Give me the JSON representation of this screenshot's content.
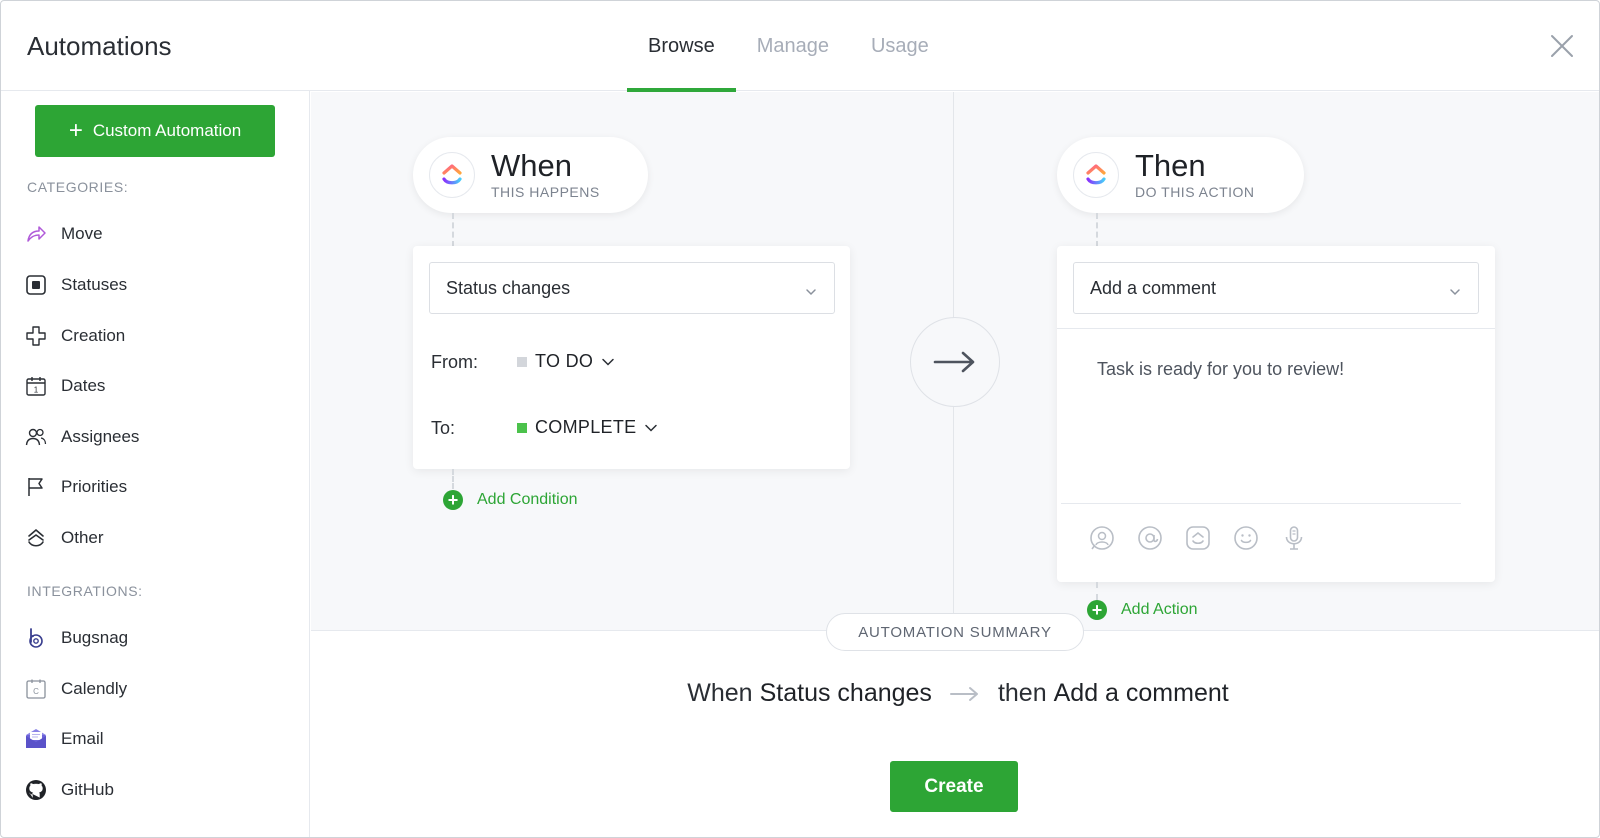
{
  "header": {
    "title": "Automations",
    "tabs": [
      {
        "label": "Browse",
        "active": true
      },
      {
        "label": "Manage",
        "active": false
      },
      {
        "label": "Usage",
        "active": false
      }
    ]
  },
  "sidebar": {
    "custom_button": "Custom Automation",
    "categories_label": "CATEGORIES:",
    "categories": [
      {
        "label": "Move",
        "icon": "move-arrow-icon"
      },
      {
        "label": "Statuses",
        "icon": "status-square-icon"
      },
      {
        "label": "Creation",
        "icon": "plus-outline-icon"
      },
      {
        "label": "Dates",
        "icon": "calendar-icon"
      },
      {
        "label": "Assignees",
        "icon": "people-icon"
      },
      {
        "label": "Priorities",
        "icon": "flag-icon"
      },
      {
        "label": "Other",
        "icon": "clickup-outline-icon"
      }
    ],
    "integrations_label": "INTEGRATIONS:",
    "integrations": [
      {
        "label": "Bugsnag",
        "icon": "bugsnag-icon"
      },
      {
        "label": "Calendly",
        "icon": "calendly-icon"
      },
      {
        "label": "Email",
        "icon": "email-icon"
      },
      {
        "label": "GitHub",
        "icon": "github-icon"
      }
    ]
  },
  "trigger": {
    "title": "When",
    "subtitle": "THIS HAPPENS",
    "select_value": "Status changes",
    "from_label": "From:",
    "from_value": "TO DO",
    "to_label": "To:",
    "to_value": "COMPLETE",
    "add_link": "Add Condition"
  },
  "action": {
    "title": "Then",
    "subtitle": "DO THIS ACTION",
    "select_value": "Add a comment",
    "comment": "Task is ready for you to review!",
    "add_link": "Add Action"
  },
  "summary": {
    "pill": "AUTOMATION SUMMARY",
    "when_word": "When",
    "when_value": "Status changes",
    "then_word": "then",
    "then_value": "Add a comment"
  },
  "create_button": "Create",
  "colors": {
    "accent": "#2da535",
    "todo_status": "#d3d6db",
    "complete_status": "#4cc24c"
  }
}
